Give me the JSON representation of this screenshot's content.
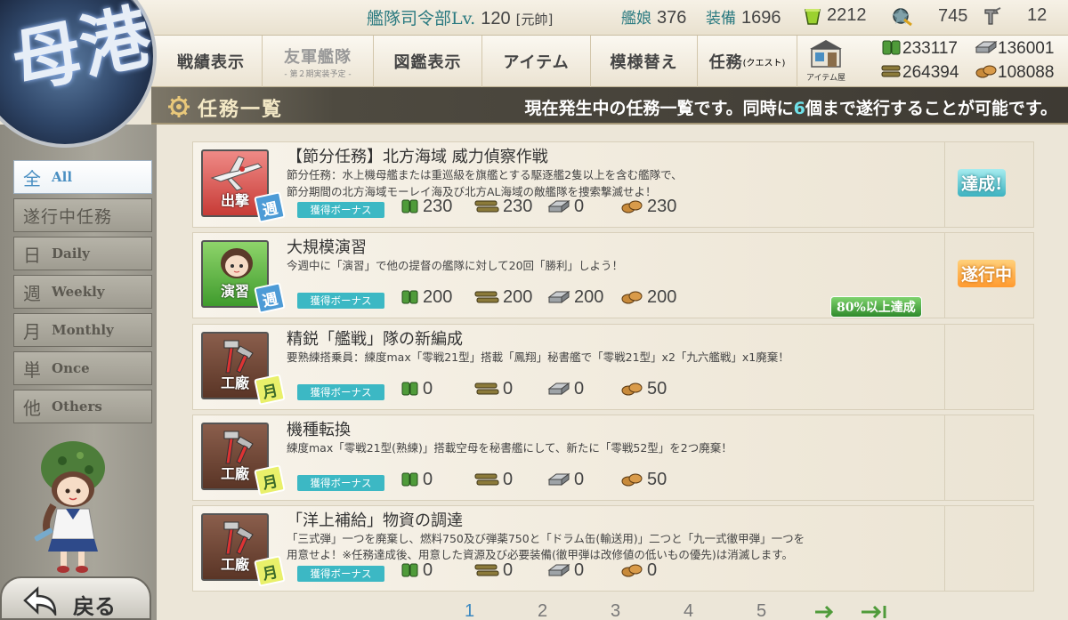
{
  "topbar": {
    "hq_label": "艦隊司令部",
    "lv_label": "Lv.",
    "level": "120",
    "rank": "[元帥]",
    "ships_label": "艦娘",
    "ships": "376",
    "equip_label": "装備",
    "equip": "1696",
    "buckets": "2212",
    "dev_mats": "745",
    "screws": "12"
  },
  "nav": {
    "record": "戦績表示",
    "friend": "友軍艦隊",
    "friend_sub": "- 第２期実装予定 -",
    "album": "図鑑表示",
    "item": "アイテム",
    "furniture": "模様替え",
    "quest": "任務",
    "quest_sub": "(クエスト)",
    "shop": "アイテム屋"
  },
  "resources": {
    "fuel": "233117",
    "steel": "136001",
    "ammo": "264394",
    "bauxite": "108088"
  },
  "banner": {
    "title": "任務一覧",
    "info_pre": "現在発生中の任務一覧です。同時に",
    "info_num": "6",
    "info_post": "個まで遂行することが可能です。"
  },
  "emblem": {
    "text": "母港"
  },
  "categories": [
    {
      "kanji": "全",
      "en": "All",
      "active": true
    },
    {
      "kanji": "遂行中任務",
      "en": ""
    },
    {
      "kanji": "日",
      "en": "Daily"
    },
    {
      "kanji": "週",
      "en": "Weekly"
    },
    {
      "kanji": "月",
      "en": "Monthly"
    },
    {
      "kanji": "単",
      "en": "Once"
    },
    {
      "kanji": "他",
      "en": "Others"
    }
  ],
  "back": "戻る",
  "bonus_label": "獲得ボーナス",
  "quests": [
    {
      "title": "【節分任務】北方海域 威力偵察作戦",
      "desc1": "節分任務：水上機母艦または重巡級を旗艦とする駆逐艦2隻以上を含む艦隊で、",
      "desc2": "節分期間の北方海域モーレイ海及び北方AL海域の敵艦隊を捜索撃滅せよ！",
      "category": "出撃",
      "badge": "週",
      "rewards": [
        "230",
        "230",
        "0",
        "230"
      ],
      "status": "達成!"
    },
    {
      "title": "大規模演習",
      "desc1": "今週中に「演習」で他の提督の艦隊に対して20回「勝利」しよう！",
      "desc2": "",
      "category": "演習",
      "badge": "週",
      "rewards": [
        "200",
        "200",
        "200",
        "200"
      ],
      "status": "遂行中",
      "progress": "80%以上達成"
    },
    {
      "title": "精鋭「艦戦」隊の新編成",
      "desc1": "要熟練搭乗員：練度max「零戦21型」搭載「鳳翔」秘書艦で「零戦21型」x2「九六艦戦」x1廃棄！",
      "desc2": "",
      "category": "工廠",
      "badge": "月",
      "rewards": [
        "0",
        "0",
        "0",
        "50"
      ]
    },
    {
      "title": "機種転換",
      "desc1": "練度max「零戦21型(熟練)」搭載空母を秘書艦にして、新たに「零戦52型」を2つ廃棄！",
      "desc2": "",
      "category": "工廠",
      "badge": "月",
      "rewards": [
        "0",
        "0",
        "0",
        "50"
      ]
    },
    {
      "title": "「洋上補給」物資の調達",
      "desc1": "「三式弾」一つを廃棄し、燃料750及び弾薬750と「ドラム缶(輸送用)」二つと「九一式徹甲弾」一つを",
      "desc2": "用意せよ！※任務達成後、用意した資源及び必要装備(徹甲弾は改修値の低いもの優先)は消滅します。",
      "category": "工廠",
      "badge": "月",
      "rewards": [
        "0",
        "0",
        "0",
        "0"
      ]
    }
  ],
  "pager": {
    "pages": [
      "1",
      "2",
      "3",
      "4",
      "5"
    ],
    "current": "1"
  }
}
